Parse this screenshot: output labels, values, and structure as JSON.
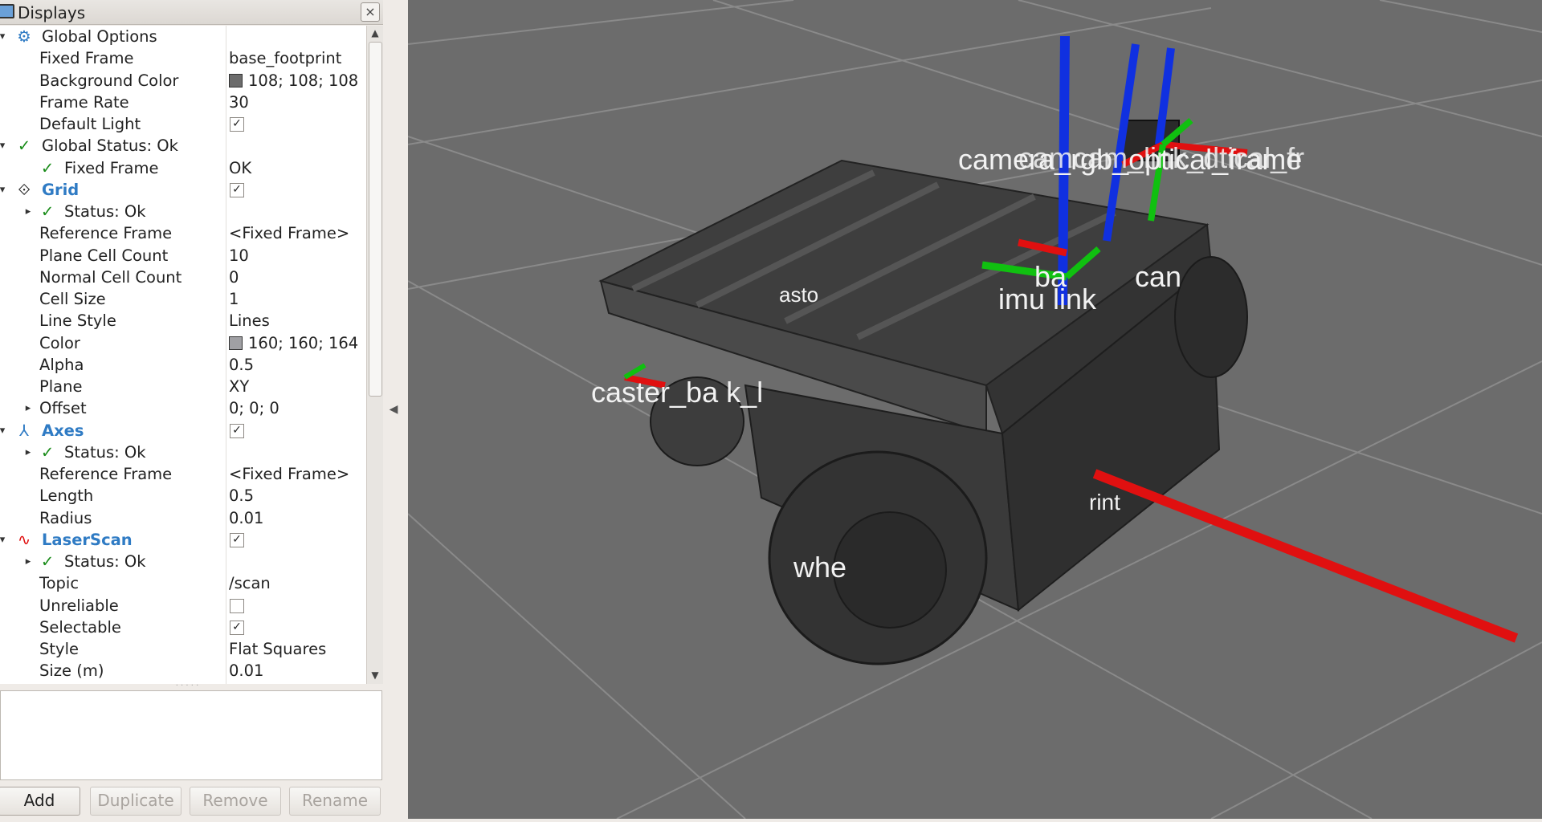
{
  "panel": {
    "title": "Displays",
    "close_glyph": "×",
    "rows": [
      {
        "indent": 0,
        "expand": "open",
        "icon": "gear-icon",
        "iconGlyph": "⚙",
        "name": "Global Options",
        "style": "",
        "value": "",
        "kind": "none"
      },
      {
        "indent": 1,
        "expand": "",
        "icon": "",
        "iconGlyph": "",
        "name": "Fixed Frame",
        "style": "",
        "value": "base_footprint",
        "kind": "text"
      },
      {
        "indent": 1,
        "expand": "",
        "icon": "",
        "iconGlyph": "",
        "name": "Background Color",
        "style": "",
        "value": "108; 108; 108",
        "kind": "color",
        "color": "#6c6c6c"
      },
      {
        "indent": 1,
        "expand": "",
        "icon": "",
        "iconGlyph": "",
        "name": "Frame Rate",
        "style": "",
        "value": "30",
        "kind": "text"
      },
      {
        "indent": 1,
        "expand": "",
        "icon": "",
        "iconGlyph": "",
        "name": "Default Light",
        "style": "",
        "value": "",
        "kind": "check",
        "checked": true
      },
      {
        "indent": 0,
        "expand": "open",
        "icon": "check-icon",
        "iconGlyph": "✓",
        "name": "Global Status: Ok",
        "style": "",
        "value": "",
        "kind": "none"
      },
      {
        "indent": 1,
        "expand": "",
        "icon": "check-icon",
        "iconGlyph": "✓",
        "name": "Fixed Frame",
        "style": "",
        "value": "OK",
        "kind": "text"
      },
      {
        "indent": 0,
        "expand": "open",
        "icon": "grid-icon",
        "iconGlyph": "⟐",
        "name": "Grid",
        "style": "blue",
        "value": "",
        "kind": "check",
        "checked": true
      },
      {
        "indent": 1,
        "expand": "closed",
        "icon": "check-icon",
        "iconGlyph": "✓",
        "name": "Status: Ok",
        "style": "",
        "value": "",
        "kind": "none"
      },
      {
        "indent": 1,
        "expand": "",
        "icon": "",
        "iconGlyph": "",
        "name": "Reference Frame",
        "style": "",
        "value": "<Fixed Frame>",
        "kind": "text"
      },
      {
        "indent": 1,
        "expand": "",
        "icon": "",
        "iconGlyph": "",
        "name": "Plane Cell Count",
        "style": "",
        "value": "10",
        "kind": "text"
      },
      {
        "indent": 1,
        "expand": "",
        "icon": "",
        "iconGlyph": "",
        "name": "Normal Cell Count",
        "style": "",
        "value": "0",
        "kind": "text"
      },
      {
        "indent": 1,
        "expand": "",
        "icon": "",
        "iconGlyph": "",
        "name": "Cell Size",
        "style": "",
        "value": "1",
        "kind": "text"
      },
      {
        "indent": 1,
        "expand": "",
        "icon": "",
        "iconGlyph": "",
        "name": "Line Style",
        "style": "",
        "value": "Lines",
        "kind": "text"
      },
      {
        "indent": 1,
        "expand": "",
        "icon": "",
        "iconGlyph": "",
        "name": "Color",
        "style": "",
        "value": "160; 160; 164",
        "kind": "color",
        "color": "#a0a0a4"
      },
      {
        "indent": 1,
        "expand": "",
        "icon": "",
        "iconGlyph": "",
        "name": "Alpha",
        "style": "",
        "value": "0.5",
        "kind": "text"
      },
      {
        "indent": 1,
        "expand": "",
        "icon": "",
        "iconGlyph": "",
        "name": "Plane",
        "style": "",
        "value": "XY",
        "kind": "text"
      },
      {
        "indent": 1,
        "expand": "closed",
        "icon": "",
        "iconGlyph": "",
        "name": "Offset",
        "style": "",
        "value": "0; 0; 0",
        "kind": "text"
      },
      {
        "indent": 0,
        "expand": "open",
        "icon": "axes-icon",
        "iconGlyph": "⅄",
        "name": "Axes",
        "style": "blue",
        "value": "",
        "kind": "check",
        "checked": true
      },
      {
        "indent": 1,
        "expand": "closed",
        "icon": "check-icon",
        "iconGlyph": "✓",
        "name": "Status: Ok",
        "style": "",
        "value": "",
        "kind": "none"
      },
      {
        "indent": 1,
        "expand": "",
        "icon": "",
        "iconGlyph": "",
        "name": "Reference Frame",
        "style": "",
        "value": "<Fixed Frame>",
        "kind": "text"
      },
      {
        "indent": 1,
        "expand": "",
        "icon": "",
        "iconGlyph": "",
        "name": "Length",
        "style": "",
        "value": "0.5",
        "kind": "text"
      },
      {
        "indent": 1,
        "expand": "",
        "icon": "",
        "iconGlyph": "",
        "name": "Radius",
        "style": "",
        "value": "0.01",
        "kind": "text"
      },
      {
        "indent": 0,
        "expand": "open",
        "icon": "laserscan-icon",
        "iconGlyph": "∿",
        "name": "LaserScan",
        "style": "blue",
        "value": "",
        "kind": "check",
        "checked": true
      },
      {
        "indent": 1,
        "expand": "closed",
        "icon": "check-icon",
        "iconGlyph": "✓",
        "name": "Status: Ok",
        "style": "",
        "value": "",
        "kind": "none"
      },
      {
        "indent": 1,
        "expand": "",
        "icon": "",
        "iconGlyph": "",
        "name": "Topic",
        "style": "",
        "value": "/scan",
        "kind": "text"
      },
      {
        "indent": 1,
        "expand": "",
        "icon": "",
        "iconGlyph": "",
        "name": "Unreliable",
        "style": "",
        "value": "",
        "kind": "check",
        "checked": false
      },
      {
        "indent": 1,
        "expand": "",
        "icon": "",
        "iconGlyph": "",
        "name": "Selectable",
        "style": "",
        "value": "",
        "kind": "check",
        "checked": true
      },
      {
        "indent": 1,
        "expand": "",
        "icon": "",
        "iconGlyph": "",
        "name": "Style",
        "style": "",
        "value": "Flat Squares",
        "kind": "text"
      },
      {
        "indent": 1,
        "expand": "",
        "icon": "",
        "iconGlyph": "",
        "name": "Size (m)",
        "style": "",
        "value": "0.01",
        "kind": "text"
      }
    ],
    "buttons": {
      "add": "Add",
      "duplicate": "Duplicate",
      "remove": "Remove",
      "rename": "Rename"
    }
  },
  "view": {
    "background_color": "#6c6c6c",
    "frame_labels": {
      "camera": "camera_rgb_optical_frame",
      "camera_overlap": "camcam_link_dtical_fr",
      "base": "ba",
      "scan": "can",
      "imu": "imu link",
      "caster": "caster_ba k_l",
      "caster_front": "asto",
      "wheel": "whe",
      "footprint": "rint"
    },
    "colors": {
      "x_axis": "#e01010",
      "y_axis": "#10c010",
      "z_axis": "#1030e0",
      "accent": "#2f7bc4",
      "ok": "#1a8c1a"
    }
  }
}
